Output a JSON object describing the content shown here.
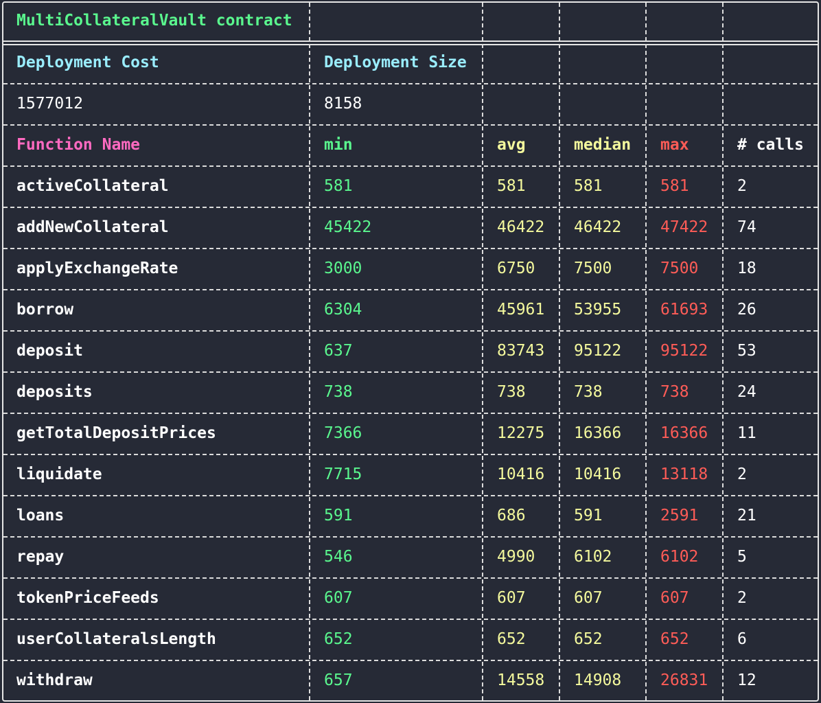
{
  "contract_title": "MultiCollateralVault contract",
  "deployment": {
    "cost_label": "Deployment Cost",
    "size_label": "Deployment Size",
    "cost_value": "1577012",
    "size_value": "8158"
  },
  "headers": {
    "function_name": "Function Name",
    "min": "min",
    "avg": "avg",
    "median": "median",
    "max": "max",
    "calls": "# calls"
  },
  "rows": [
    {
      "name": "activeCollateral",
      "min": "581",
      "avg": "581",
      "median": "581",
      "max": "581",
      "calls": "2"
    },
    {
      "name": "addNewCollateral",
      "min": "45422",
      "avg": "46422",
      "median": "46422",
      "max": "47422",
      "calls": "74"
    },
    {
      "name": "applyExchangeRate",
      "min": "3000",
      "avg": "6750",
      "median": "7500",
      "max": "7500",
      "calls": "18"
    },
    {
      "name": "borrow",
      "min": "6304",
      "avg": "45961",
      "median": "53955",
      "max": "61693",
      "calls": "26"
    },
    {
      "name": "deposit",
      "min": "637",
      "avg": "83743",
      "median": "95122",
      "max": "95122",
      "calls": "53"
    },
    {
      "name": "deposits",
      "min": "738",
      "avg": "738",
      "median": "738",
      "max": "738",
      "calls": "24"
    },
    {
      "name": "getTotalDepositPrices",
      "min": "7366",
      "avg": "12275",
      "median": "16366",
      "max": "16366",
      "calls": "11"
    },
    {
      "name": "liquidate",
      "min": "7715",
      "avg": "10416",
      "median": "10416",
      "max": "13118",
      "calls": "2"
    },
    {
      "name": "loans",
      "min": "591",
      "avg": "686",
      "median": "591",
      "max": "2591",
      "calls": "21"
    },
    {
      "name": "repay",
      "min": "546",
      "avg": "4990",
      "median": "6102",
      "max": "6102",
      "calls": "5"
    },
    {
      "name": "tokenPriceFeeds",
      "min": "607",
      "avg": "607",
      "median": "607",
      "max": "607",
      "calls": "2"
    },
    {
      "name": "userCollateralsLength",
      "min": "652",
      "avg": "652",
      "median": "652",
      "max": "652",
      "calls": "6"
    },
    {
      "name": "withdraw",
      "min": "657",
      "avg": "14558",
      "median": "14908",
      "max": "26831",
      "calls": "12"
    }
  ],
  "colors": {
    "background": "#262a36",
    "title": "#5af78e",
    "deployment_headers": "#9aedfe",
    "function_name_header": "#ff6ac1",
    "min": "#5af78e",
    "avg_median": "#f4f99d",
    "max": "#ff5c57",
    "text": "#ffffff"
  }
}
